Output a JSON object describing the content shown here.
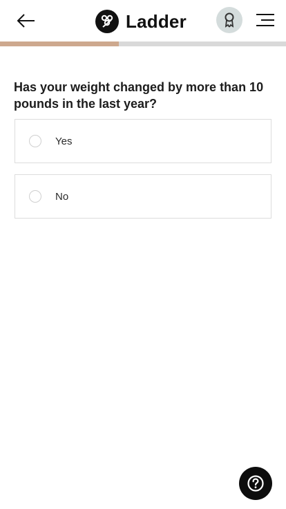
{
  "header": {
    "brand_name": "Ladder",
    "back_icon": "arrow-left-icon",
    "logo_icon": "ladder-logo-icon",
    "badge_icon": "award-ribbon-icon",
    "menu_icon": "hamburger-menu-icon"
  },
  "progress": {
    "fraction": 0.415,
    "fill_color": "#cda88e",
    "track_color": "#d9d9d9"
  },
  "question": {
    "text": "Has your weight changed by more than 10 pounds in the last year?"
  },
  "options": [
    {
      "label": "Yes",
      "selected": false
    },
    {
      "label": "No",
      "selected": false
    }
  ],
  "help": {
    "icon": "question-mark-icon"
  }
}
